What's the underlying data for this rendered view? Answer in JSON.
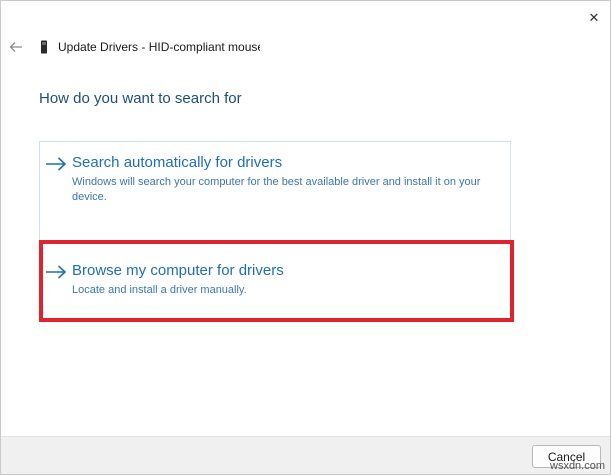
{
  "window": {
    "title": "Update Drivers - HID-compliant mouse",
    "close_glyph": "✕"
  },
  "heading": "How do you want to search for",
  "options": [
    {
      "title": "Search automatically for drivers",
      "description": "Windows will search your computer for the best available driver and install it on your device."
    },
    {
      "title": "Browse my computer for drivers",
      "description": "Locate and install a driver manually."
    }
  ],
  "footer": {
    "cancel_label": "Cancel"
  },
  "watermark": "wsxdn.com",
  "colors": {
    "link": "#1f6fb0",
    "heading": "#1f4e79",
    "highlight": "#e0242f"
  },
  "icons": {
    "back": "back-arrow-icon",
    "device": "device-icon",
    "option_arrow": "arrow-right-icon",
    "close": "close-icon"
  }
}
